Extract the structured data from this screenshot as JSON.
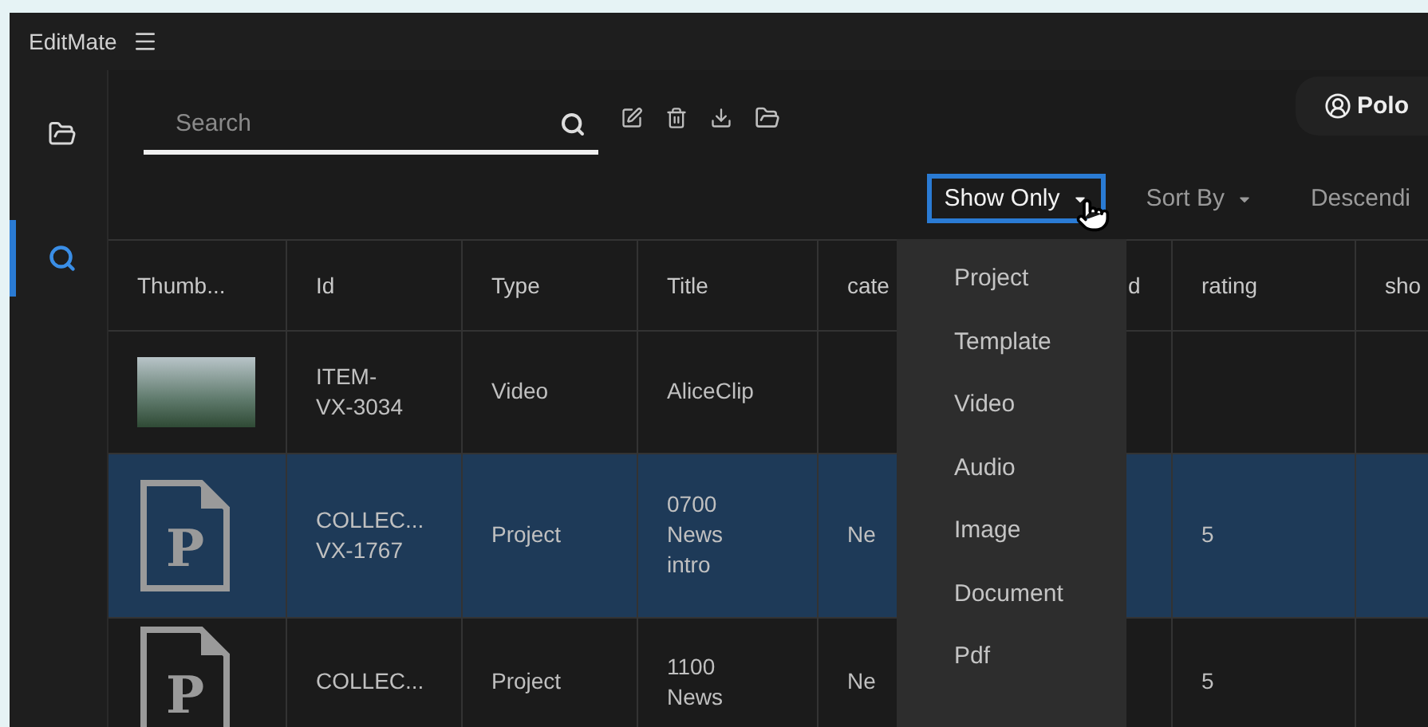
{
  "app": {
    "title": "EditMate"
  },
  "sidebar": {
    "items": [
      {
        "kind": "folder",
        "selected": false
      },
      {
        "kind": "search",
        "selected": true
      }
    ]
  },
  "search": {
    "placeholder": "Search"
  },
  "user": {
    "name": "Polo"
  },
  "filters": [
    {
      "label": "Show Only",
      "kind": "dropdown",
      "open": true
    },
    {
      "label": "Sort By",
      "kind": "dropdown",
      "open": false
    },
    {
      "label": "Descendi",
      "kind": "toggle",
      "open": false
    }
  ],
  "dropdown": {
    "items": [
      "Project",
      "Template",
      "Video",
      "Audio",
      "Image",
      "Document",
      "Pdf"
    ]
  },
  "table": {
    "columns": [
      "Thumb...",
      "Id",
      "Type",
      "Title",
      "cate",
      "d",
      "rating",
      "sho"
    ],
    "rows": [
      {
        "selected": false,
        "thumbnail": {
          "kind": "photo"
        },
        "cells": [
          "",
          "ITEM-\nVX-3034",
          "Video",
          "AliceClip",
          "",
          "",
          "",
          ""
        ]
      },
      {
        "selected": true,
        "thumbnail": {
          "kind": "project",
          "letter": "P"
        },
        "cells": [
          "",
          "COLLEC...\nVX-1767",
          "Project",
          "0700\nNews\nintro",
          "Ne",
          "",
          "5",
          ""
        ]
      },
      {
        "selected": false,
        "thumbnail": {
          "kind": "project",
          "letter": "P"
        },
        "cells": [
          "",
          "COLLEC...",
          "Project",
          "1100\nNews",
          "Ne",
          "",
          "5",
          ""
        ]
      }
    ]
  }
}
